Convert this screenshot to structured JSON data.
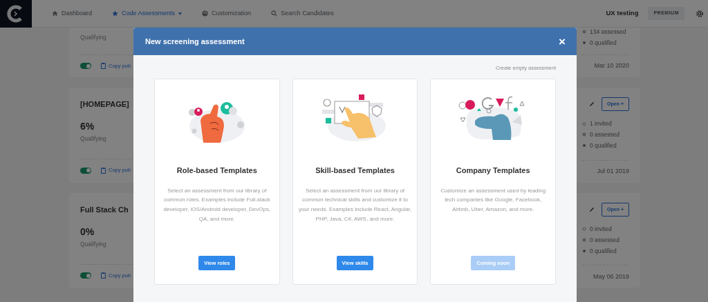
{
  "navbar": {
    "items": [
      {
        "label": "Dashboard",
        "selected": false
      },
      {
        "label": "Code Assessments",
        "selected": true,
        "dropdown": true
      },
      {
        "label": "Customization",
        "selected": false
      },
      {
        "label": "Search Candidates",
        "selected": false
      }
    ],
    "account": "UX testing",
    "plan_badge": "PREMIUM"
  },
  "assessments": [
    {
      "qualifying": "Qualifying",
      "active": true,
      "link": "Copy pub",
      "stats": [
        {
          "kind": "assessed",
          "label": "134 assessed"
        },
        {
          "kind": "qualified",
          "label": "0 qualified"
        }
      ],
      "date": "Mar 10 2020"
    },
    {
      "title": "[HOMEPAGE]",
      "percent": "6%",
      "qualifying": "Qualifying",
      "active": true,
      "link": "Copy pub",
      "open_button": "Open +",
      "stats": [
        {
          "kind": "invited",
          "label": "1 invited"
        },
        {
          "kind": "assessed",
          "label": "0 assessed"
        },
        {
          "kind": "qualified",
          "label": "0 qualified"
        }
      ],
      "date": "Jul 01 2019"
    },
    {
      "title": "Full Stack Ch",
      "percent": "0%",
      "qualifying": "Qualifying",
      "active": true,
      "link": "Copy pub",
      "open_button": "Open +",
      "stats": [
        {
          "kind": "invited",
          "label": "0 invited"
        },
        {
          "kind": "assessed",
          "label": "0 assessed"
        },
        {
          "kind": "qualified",
          "label": "0 qualified"
        }
      ],
      "date": "May 06 2019"
    }
  ],
  "modal": {
    "title": "New screening assessment",
    "close": "×",
    "create_empty": "Create empty assessment",
    "templates": [
      {
        "kind": "role",
        "title": "Role-based Templates",
        "description": "Select an assessment from our library of common roles. Examples include Full-stack developer, iOS/Android developer, DevOps, QA, and more.",
        "button": {
          "label": "View roles",
          "disabled": false
        }
      },
      {
        "kind": "skill",
        "title": "Skill-based Templates",
        "description": "Select an assessment from our library of common technical skills and customize it to your needs. Examples include React, Angular, PHP, Java, C#, AWS, and more.",
        "button": {
          "label": "View skills",
          "disabled": false
        }
      },
      {
        "kind": "company",
        "title": "Company Templates",
        "description": "Customize an assessment used by leading tech companies like Google, Facebook, Airbnb, Uber, Amazon, and more.",
        "button": {
          "label": "Coming soon",
          "disabled": true
        }
      }
    ]
  }
}
